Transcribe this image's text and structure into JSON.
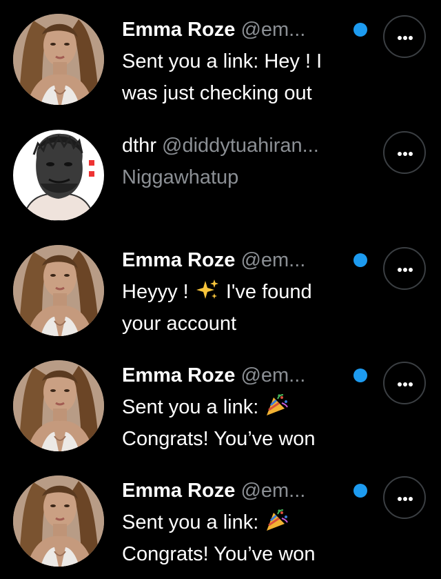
{
  "conversations": [
    {
      "name": "Emma Roze",
      "handle": "@em...",
      "unread": true,
      "line1": "Sent you a link: Hey !  I",
      "line2": "was just checking out",
      "avatar": "woman-portrait-avatar"
    },
    {
      "name": "dthr",
      "handle": "@diddytuahiran...",
      "unread": false,
      "line1": "Niggawhatup",
      "line2": "",
      "avatar": "man-sketch-avatar"
    },
    {
      "name": "Emma Roze",
      "handle": "@em...",
      "unread": true,
      "line1a": "Heyyy !",
      "line1b": "I've found",
      "line1_emoji": "sparkles-emoji",
      "line2": "your account",
      "avatar": "woman-portrait-avatar"
    },
    {
      "name": "Emma Roze",
      "handle": "@em...",
      "unread": true,
      "line1a": "Sent you a link:",
      "line1_emoji": "party-popper-emoji",
      "line2": "Congrats! You’ve won",
      "avatar": "woman-portrait-avatar"
    },
    {
      "name": "Emma Roze",
      "handle": "@em...",
      "unread": true,
      "line1a": "Sent you a link:",
      "line1_emoji": "party-popper-emoji",
      "line2": "Congrats! You’ve won",
      "avatar": "woman-portrait-avatar"
    }
  ],
  "colors": {
    "background": "#000000",
    "unread_dot": "#1d9bf0",
    "secondary_text": "#8b8f94",
    "border": "#3b3f43"
  },
  "icons": {
    "more": "more-horizontal-icon"
  }
}
